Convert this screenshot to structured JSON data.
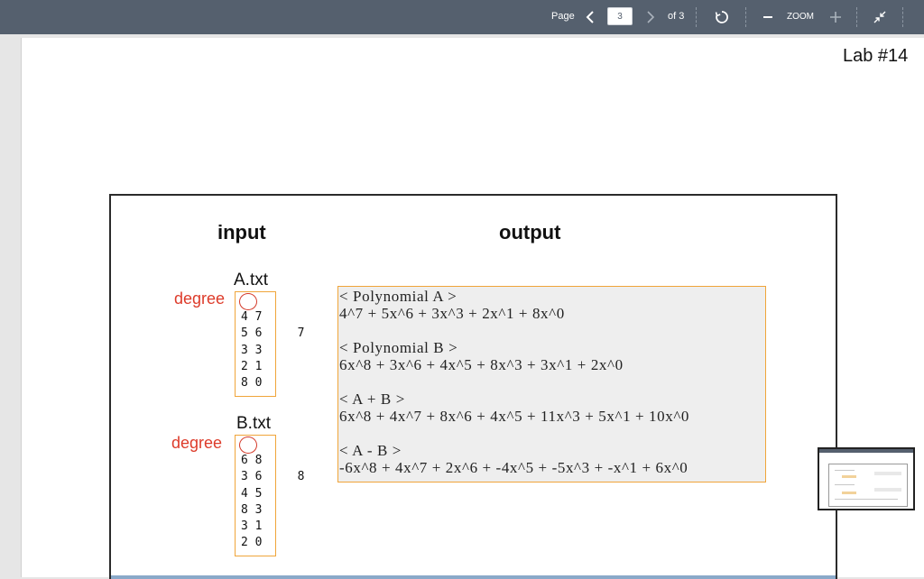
{
  "toolbar": {
    "page_label": "Page",
    "current_page": "3",
    "of_label": "of 3",
    "zoom_label": "ZOOM",
    "icons": [
      "chevron-left-icon",
      "chevron-right-icon",
      "refresh-icon",
      "minus-icon",
      "plus-icon",
      "collapse-icon"
    ]
  },
  "document": {
    "lab_title": "Lab #14",
    "input_heading": "input",
    "output_heading": "output",
    "file_a": {
      "name": "A.txt",
      "degree_label": "degree",
      "degree": "7",
      "lines": [
        "4 7",
        "5 6",
        "3 3",
        "2 1",
        "8 0"
      ]
    },
    "file_b": {
      "name": "B.txt",
      "degree_label": "degree",
      "degree": "8",
      "lines": [
        "6 8",
        "3 6",
        "4 5",
        "8 3",
        "3 1",
        "2 0"
      ]
    },
    "output": {
      "sections": [
        {
          "header": "< Polynomial A >",
          "value": "4^7 + 5x^6 + 3x^3 + 2x^1 + 8x^0"
        },
        {
          "header": "< Polynomial B >",
          "value": "6x^8 + 3x^6 + 4x^5 + 8x^3 + 3x^1 + 2x^0"
        },
        {
          "header": "< A + B >",
          "value": "6x^8 + 4x^7 + 8x^6 + 4x^5 + 11x^3 + 5x^1 + 10x^0"
        },
        {
          "header": "< A - B >",
          "value": "-6x^8 + 4x^7 + 2x^6 + -4x^5 + -5x^3 + -x^1 + 6x^0"
        }
      ]
    }
  },
  "colors": {
    "toolbar_bg": "#55606e",
    "highlight_orange": "#f0a53a",
    "degree_red": "#dd3b2a",
    "output_bg": "#eeeeee"
  }
}
